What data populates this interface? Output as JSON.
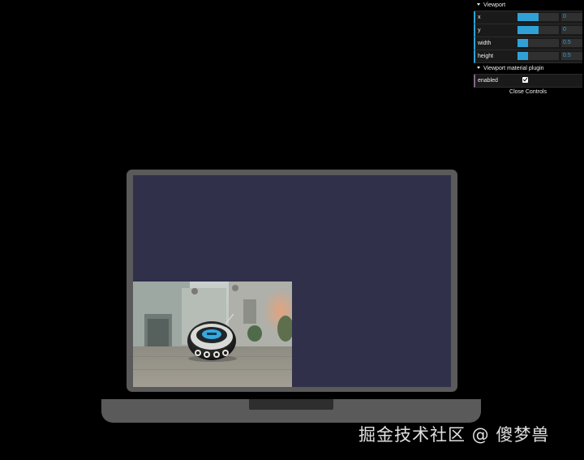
{
  "gui": {
    "folders": [
      {
        "title": "Viewport",
        "controls": [
          {
            "label": "x",
            "value": "0",
            "fill": 0.5
          },
          {
            "label": "y",
            "value": "0",
            "fill": 0.5
          },
          {
            "label": "width",
            "value": "0.5",
            "fill": 0.25
          },
          {
            "label": "height",
            "value": "0.5",
            "fill": 0.25
          }
        ]
      },
      {
        "title": "Viewport material plugin",
        "controls": [
          {
            "label": "enabled",
            "checked": true
          }
        ]
      }
    ],
    "close_label": "Close Controls"
  },
  "scene": {
    "screen_color": "#30304a",
    "viewport_scene": "boombox-on-paved-courtyard"
  },
  "watermark": "掘金技术社区 @ 傻梦兽",
  "colors": {
    "accent": "#2fa1d6",
    "bool_accent": "#806787",
    "laptop_body": "#5a5a5a"
  }
}
